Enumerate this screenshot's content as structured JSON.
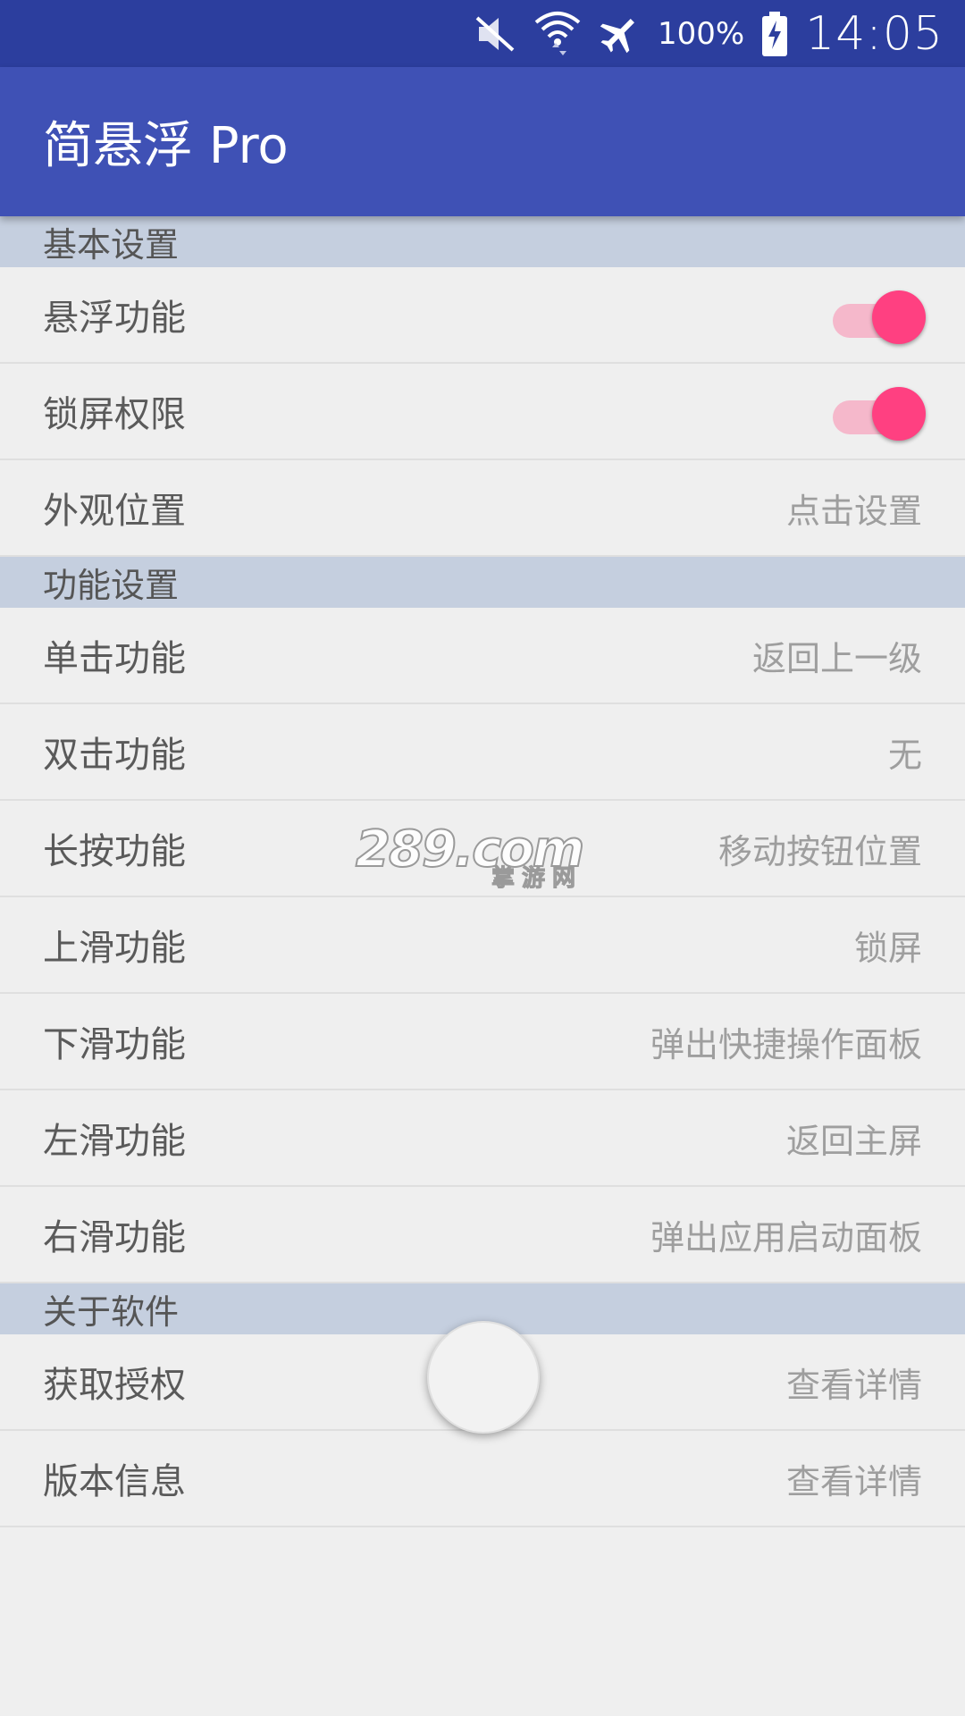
{
  "status_bar": {
    "battery_pct": "100%",
    "time": "14:05",
    "icons": [
      "mute-icon",
      "wifi-icon",
      "airplane-mode-icon",
      "battery-charging-icon"
    ]
  },
  "app_bar": {
    "title": "简悬浮 Pro"
  },
  "sections": {
    "basic": {
      "header": "基本设置",
      "float_feature": {
        "label": "悬浮功能",
        "enabled": true
      },
      "lock_permission": {
        "label": "锁屏权限",
        "enabled": true
      },
      "appearance": {
        "label": "外观位置",
        "value": "点击设置"
      }
    },
    "function": {
      "header": "功能设置",
      "single_tap": {
        "label": "单击功能",
        "value": "返回上一级"
      },
      "double_tap": {
        "label": "双击功能",
        "value": "无"
      },
      "long_press": {
        "label": "长按功能",
        "value": "移动按钮位置"
      },
      "swipe_up": {
        "label": "上滑功能",
        "value": "锁屏"
      },
      "swipe_down": {
        "label": "下滑功能",
        "value": "弹出快捷操作面板"
      },
      "swipe_left": {
        "label": "左滑功能",
        "value": "返回主屏"
      },
      "swipe_right": {
        "label": "右滑功能",
        "value": "弹出应用启动面板"
      }
    },
    "about": {
      "header": "关于软件",
      "authorization": {
        "label": "获取授权",
        "value": "查看详情"
      },
      "version": {
        "label": "版本信息",
        "value": "查看详情"
      }
    }
  },
  "watermark": {
    "main": "289.com",
    "sub": "掌游网"
  },
  "colors": {
    "status_bar": "#2c3e9e",
    "app_bar": "#3f51b5",
    "section_header": "#c5cfdf",
    "accent": "#ff4081",
    "background": "#efefef"
  }
}
